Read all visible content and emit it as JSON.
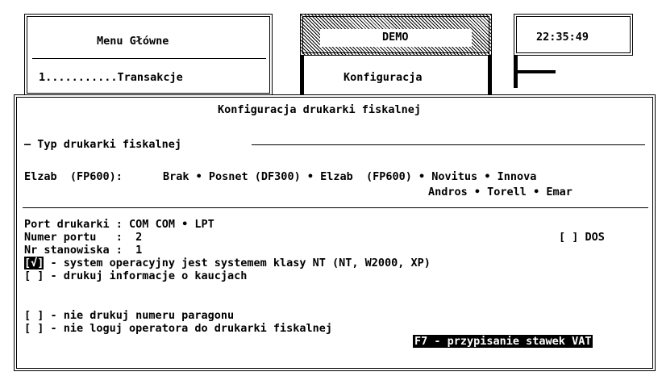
{
  "menu_box": {
    "title": "Menu Główne",
    "item": "1...........Transakcje"
  },
  "demo_box": {
    "title": "DEMO",
    "item": "Konfiguracja"
  },
  "clock": "22:35:49",
  "dialog": {
    "title": "Konfiguracja drukarki fiskalnej",
    "section_label": "— Typ drukarki fiskalnej",
    "current_type": "Elzab  (FP600): ",
    "printer_options_row1": [
      {
        "label": "Brak",
        "selected": false
      },
      {
        "label": "Posnet (DF300)",
        "selected": false
      },
      {
        "label": "Elzab  (FP600)",
        "selected": true
      },
      {
        "label": "Novitus",
        "selected": false
      },
      {
        "label": "Innova",
        "selected": false
      }
    ],
    "printer_options_row2": [
      {
        "label": "Andros",
        "selected": false
      },
      {
        "label": "Torell",
        "selected": false
      },
      {
        "label": "Emar",
        "selected": false
      }
    ],
    "port_label": "Port drukarki : COM ",
    "port_options": [
      "COM",
      "LPT"
    ],
    "port_number_label": "Numer portu   :  ",
    "port_number": "2",
    "workstation_label": "Nr stanowiska :  ",
    "workstation": "1",
    "dos_checkbox": {
      "mark": "[ ]",
      "label": "DOS"
    },
    "checkboxes": [
      {
        "mark": "[√]",
        "label": " - system operacyjny jest systemem klasy NT (NT, W2000, XP)",
        "focused": true
      },
      {
        "mark": "[ ]",
        "label": " - drukuj informacje o kaucjach",
        "focused": false
      },
      {
        "mark": "[ ]",
        "label": " - nie drukuj numeru paragonu",
        "focused": false
      },
      {
        "mark": "[ ]",
        "label": " - nie loguj operatora do drukarki fiskalnej",
        "focused": false
      }
    ],
    "function_key": "F7 - przypisanie stawek VAT"
  },
  "colors": {
    "foreground": "#000000",
    "background": "#ffffff"
  }
}
